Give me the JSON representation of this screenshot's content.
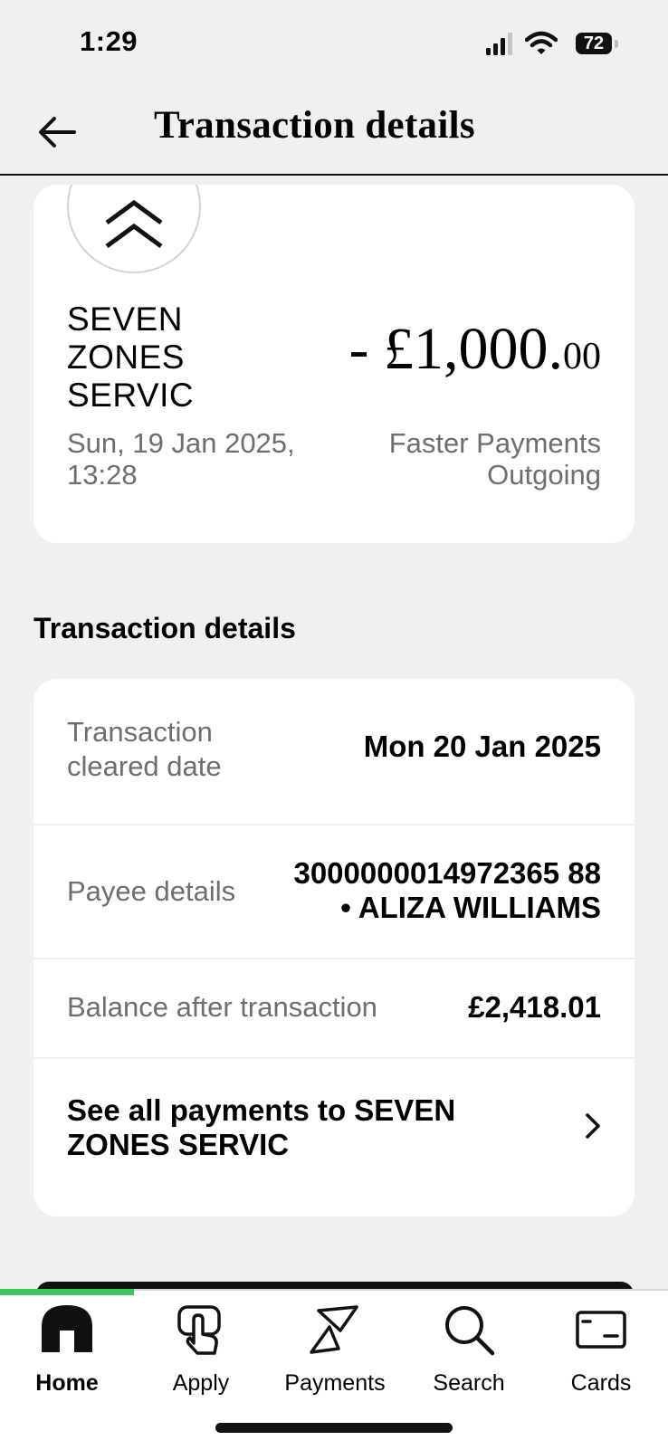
{
  "status_bar": {
    "time": "1:29",
    "battery": "72"
  },
  "header": {
    "title": "Transaction details"
  },
  "summary": {
    "merchant": "SEVEN ZONES SERVIC",
    "amount_sign": "- ",
    "amount_main": "£1,000.",
    "amount_pence": "00",
    "datetime": "Sun, 19 Jan 2025, 13:28",
    "type": "Faster Payments Outgoing"
  },
  "details": {
    "heading": "Transaction details",
    "rows": [
      {
        "label": "Transaction cleared date",
        "value": "Mon 20 Jan 2025"
      },
      {
        "label": "Payee details",
        "value": "3000000014972365 88 • ALIZA WILLIAMS"
      },
      {
        "label": "Balance after transaction",
        "value": "£2,418.01"
      }
    ],
    "link": "See all payments to SEVEN ZONES SERVIC"
  },
  "tabbar": {
    "active": "Home",
    "progress_fraction": 0.2,
    "tabs": [
      {
        "label": "Home",
        "icon": "home-icon"
      },
      {
        "label": "Apply",
        "icon": "apply-hand-icon"
      },
      {
        "label": "Payments",
        "icon": "payments-icon"
      },
      {
        "label": "Search",
        "icon": "search-icon"
      },
      {
        "label": "Cards",
        "icon": "card-icon"
      }
    ]
  },
  "colors": {
    "accent_green": "#36c95a",
    "muted_text": "#6e6e6e",
    "background": "#f0f0f0"
  }
}
